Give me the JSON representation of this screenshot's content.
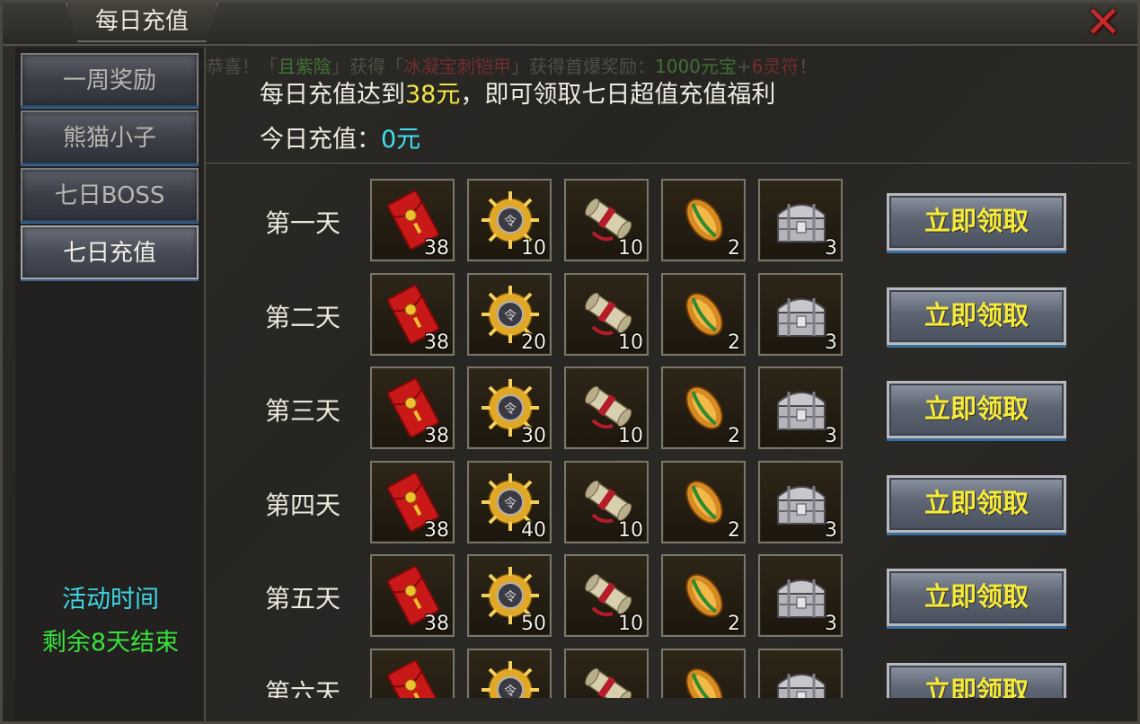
{
  "window": {
    "title": "每日充值",
    "close_icon": "close-x-icon"
  },
  "sidebar": {
    "tabs": [
      {
        "label": "一周奖励",
        "active": false
      },
      {
        "label": "熊猫小子",
        "active": false
      },
      {
        "label": "七日BOSS",
        "active": false
      },
      {
        "label": "七日充值",
        "active": true
      }
    ],
    "activity_time_label": "活动时间",
    "remaining_label": "剩余8天结束"
  },
  "marquee": {
    "prefix": "恭喜！「",
    "player": "且紫陰",
    "mid": "」获得「",
    "item": "冰凝宝刺铠甲",
    "suffix": "」获得首爆奖励：",
    "reward1": "1000元宝",
    "plus": "+",
    "reward2": "6灵符",
    "end": "！"
  },
  "info": {
    "line1_prefix": "每日充值达到",
    "line1_amount": "38元",
    "line1_suffix": "，即可领取七日超值充值福利",
    "line2_prefix": "今日充值：",
    "line2_amount": "0元"
  },
  "colors": {
    "highlight_yellow": "#f4e646",
    "highlight_cyan": "#3fe0f0",
    "time_cyan": "#3fd6e6",
    "remaining_green": "#38e23e",
    "claim_text": "#f6ea38"
  },
  "item_icons": [
    "red-envelope-icon",
    "gold-medallion-icon",
    "scroll-icon",
    "jade-leaf-icon",
    "silver-chest-icon"
  ],
  "rows": [
    {
      "day": "第一天",
      "quantities": [
        "38",
        "10",
        "10",
        "2",
        "3"
      ],
      "button": "立即领取"
    },
    {
      "day": "第二天",
      "quantities": [
        "38",
        "20",
        "10",
        "2",
        "3"
      ],
      "button": "立即领取"
    },
    {
      "day": "第三天",
      "quantities": [
        "38",
        "30",
        "10",
        "2",
        "3"
      ],
      "button": "立即领取"
    },
    {
      "day": "第四天",
      "quantities": [
        "38",
        "40",
        "10",
        "2",
        "3"
      ],
      "button": "立即领取"
    },
    {
      "day": "第五天",
      "quantities": [
        "38",
        "50",
        "10",
        "2",
        "3"
      ],
      "button": "立即领取"
    },
    {
      "day": "第六天",
      "quantities": [
        "",
        "",
        "",
        "",
        ""
      ],
      "button": "立即领取"
    }
  ]
}
